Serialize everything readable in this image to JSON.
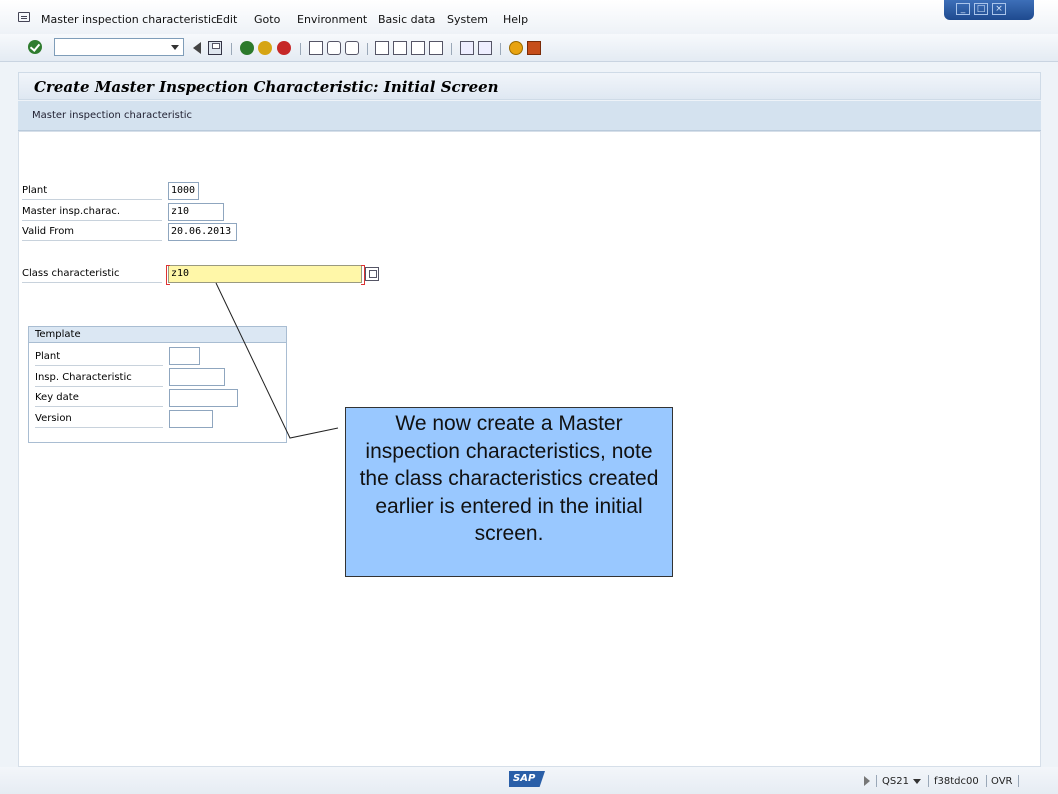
{
  "menubar": {
    "items": [
      "Master inspection characteristic",
      "Edit",
      "Goto",
      "Environment",
      "Basic data",
      "System",
      "Help"
    ]
  },
  "toolbar": {
    "command_value": "",
    "icons": [
      "enter-icon",
      "back-icon",
      "save-icon",
      "back-nav-icon",
      "exit-icon",
      "cancel-icon",
      "print-icon",
      "find-icon",
      "find-next-icon",
      "first-page-icon",
      "previous-page-icon",
      "next-page-icon",
      "last-page-icon",
      "create-session-icon",
      "shortcut-icon",
      "help-icon",
      "layout-icon"
    ]
  },
  "title": "Create Master Inspection Characteristic: Initial Screen",
  "app_toolbar": {
    "button_label": "Master inspection characteristic"
  },
  "form": {
    "plant_label": "Plant",
    "plant_value": "1000",
    "mic_label": "Master insp.charac.",
    "mic_value": "z10",
    "valid_from_label": "Valid From",
    "valid_from_value": "20.06.2013",
    "class_char_label": "Class characteristic",
    "class_char_value": "z10"
  },
  "template": {
    "heading": "Template",
    "plant_label": "Plant",
    "plant_value": "",
    "insp_char_label": "Insp. Characteristic",
    "insp_char_value": "",
    "key_date_label": "Key date",
    "key_date_value": "",
    "version_label": "Version",
    "version_value": ""
  },
  "callout": {
    "text": "We now create a Master inspection characteristics, note the class characteristics created earlier is entered in the initial screen."
  },
  "statusbar": {
    "logo": "SAP",
    "system": "QS21",
    "server": "f38tdc00",
    "mode": "OVR"
  },
  "colors": {
    "callout_bg": "#99c8ff",
    "active_field": "#fff7a8",
    "title_strip": "#dfe8f2"
  }
}
